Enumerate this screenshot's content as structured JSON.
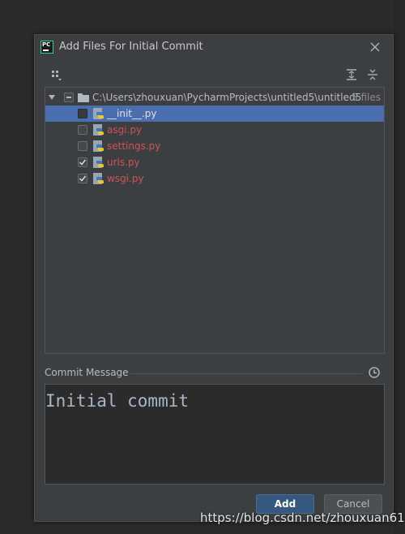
{
  "dialog": {
    "title": "Add Files For Initial Commit",
    "app_icon_text": "PC"
  },
  "tree": {
    "root": {
      "path": "C:\\Users\\zhouxuan\\PycharmProjects\\untitled5\\untitled5",
      "count": "5 files",
      "checkbox_state": "partial"
    },
    "files": [
      {
        "name": "__init__.py",
        "checked": false,
        "selected": true
      },
      {
        "name": "asgi.py",
        "checked": false,
        "selected": false
      },
      {
        "name": "settings.py",
        "checked": false,
        "selected": false
      },
      {
        "name": "urls.py",
        "checked": true,
        "selected": false
      },
      {
        "name": "wsgi.py",
        "checked": true,
        "selected": false
      }
    ]
  },
  "commit": {
    "label": "Commit Message",
    "value": "Initial commit"
  },
  "buttons": {
    "add": "Add",
    "cancel": "Cancel"
  },
  "watermark": "https://blog.csdn.net/zhouxuan612",
  "colors": {
    "dialog_bg": "#3c3f41",
    "selection": "#4b6eaf",
    "unversioned_file": "#d25252",
    "primary_button": "#365880"
  },
  "icons": [
    "app-logo-icon",
    "close-icon",
    "group-by-icon",
    "expand-all-icon",
    "collapse-all-icon",
    "folder-icon",
    "python-file-icon",
    "history-icon"
  ]
}
